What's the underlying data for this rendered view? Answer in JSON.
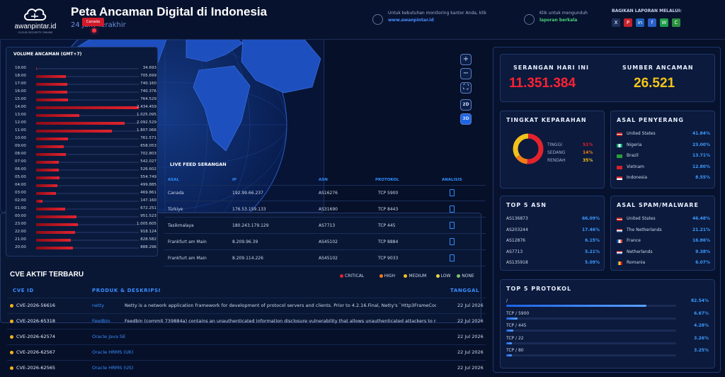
{
  "header": {
    "brand": "awanpintar.id",
    "brand_sub": "CLOUD SECURITY ONLINE",
    "title": "Peta Ancaman Digital di Indonesia",
    "subtitle": "24 Jam Terakhir",
    "promo1_text": "Untuk kebutuhan monitoring kantor Anda, klik",
    "promo1_link": "www.awanpintar.id",
    "promo2_text": "Klik untuk mengunduh",
    "promo2_link": "laporan berkala",
    "share_label": "BAGIKAN LAPORAN MELALUI:",
    "social": [
      {
        "icon": "x-icon",
        "glyph": "X",
        "color": "#1d2e59"
      },
      {
        "icon": "pinterest-icon",
        "glyph": "P",
        "color": "#c4212c"
      },
      {
        "icon": "linkedin-icon",
        "glyph": "in",
        "color": "#1f5fb8"
      },
      {
        "icon": "facebook-icon",
        "glyph": "f",
        "color": "#2a5ec9"
      },
      {
        "icon": "whatsapp-icon",
        "glyph": "W",
        "color": "#1d9c4a"
      },
      {
        "icon": "copy-icon",
        "glyph": "C",
        "color": "#2b8f3e"
      }
    ]
  },
  "volume": {
    "title": "VOLUME ANCAMAN (GMT+7)",
    "rows": [
      {
        "t": "19:00",
        "v": "34.693",
        "f": 0.01
      },
      {
        "t": "18:00",
        "v": "705.699",
        "f": 0.29
      },
      {
        "t": "17:00",
        "v": "740.160",
        "f": 0.3
      },
      {
        "t": "16:00",
        "v": "740.376",
        "f": 0.3
      },
      {
        "t": "15:00",
        "v": "764.529",
        "f": 0.31
      },
      {
        "t": "14:00",
        "v": "2.434.459",
        "f": 1.0
      },
      {
        "t": "13:00",
        "v": "1.025.095",
        "f": 0.42
      },
      {
        "t": "12:00",
        "v": "2.092.529",
        "f": 0.86
      },
      {
        "t": "11:00",
        "v": "1.807.066",
        "f": 0.74
      },
      {
        "t": "10:00",
        "v": "761.571",
        "f": 0.31
      },
      {
        "t": "09:00",
        "v": "658.053",
        "f": 0.27
      },
      {
        "t": "08:00",
        "v": "702.803",
        "f": 0.29
      },
      {
        "t": "07:00",
        "v": "542.027",
        "f": 0.22
      },
      {
        "t": "06:00",
        "v": "526.602",
        "f": 0.22
      },
      {
        "t": "05:00",
        "v": "554.749",
        "f": 0.23
      },
      {
        "t": "04:00",
        "v": "499.885",
        "f": 0.21
      },
      {
        "t": "03:00",
        "v": "469.861",
        "f": 0.19
      },
      {
        "t": "02:00",
        "v": "147.160",
        "f": 0.06
      },
      {
        "t": "01:00",
        "v": "672.251",
        "f": 0.28
      },
      {
        "t": "00:00",
        "v": "951.523",
        "f": 0.39
      },
      {
        "t": "23:00",
        "v": "1.005.605",
        "f": 0.41
      },
      {
        "t": "22:00",
        "v": "918.124",
        "f": 0.38
      },
      {
        "t": "21:00",
        "v": "828.582",
        "f": 0.34
      },
      {
        "t": "20:00",
        "v": "888.296",
        "f": 0.36
      }
    ]
  },
  "map": {
    "marker_label": "Canada",
    "buttons": {
      "zoom_in": "+",
      "zoom_out": "−",
      "fit": "⛶",
      "view_2d": "2D",
      "view_3d": "3D"
    }
  },
  "live_feed": {
    "title": "LIVE FEED SERANGAN",
    "headers": {
      "asal": "ASAL",
      "ip": "IP",
      "asn": "ASN",
      "protokol": "PROTOKOL",
      "analisis": "ANALISIS"
    },
    "rows": [
      {
        "asal": "Canada",
        "ip": "192.99.66.237",
        "asn": "AS16276",
        "protokol": "TCP 5900"
      },
      {
        "asal": "Türkiye",
        "ip": "176.53.159.133",
        "asn": "AS31690",
        "protokol": "TCP 8443"
      },
      {
        "asal": "Tasikmalaya",
        "ip": "180.243.179.129",
        "asn": "AS7713",
        "protokol": "TCP 445"
      },
      {
        "asal": "Frankfurt am Main",
        "ip": "8.209.96.39",
        "asn": "AS45102",
        "protokol": "TCP 8884"
      },
      {
        "asal": "Frankfurt am Main",
        "ip": "8.209.114.226",
        "asn": "AS45102",
        "protokol": "TCP 9033"
      }
    ]
  },
  "cve": {
    "title": "CVE AKTIF TERBARU",
    "legend": [
      {
        "label": "CRITICAL",
        "color": "#e2232e"
      },
      {
        "label": "HIGH",
        "color": "#f07c1a"
      },
      {
        "label": "MEDIUM",
        "color": "#f2c21b"
      },
      {
        "label": "LOW",
        "color": "#e6d84a"
      },
      {
        "label": "NONE",
        "color": "#7cc46a"
      }
    ],
    "headers": {
      "id": "CVE ID",
      "produk": "PRODUK & DESKRIPSI",
      "tanggal": "TANGGAL"
    },
    "rows": [
      {
        "id": "CVE-2026-56616",
        "produk": "netty",
        "desc": "Netty is a network application framework for development of protocol servers and clients. Prior to 4.2.16.Final, Netty's `Http3FrameCodec` ...",
        "tanggal": "22 Jul 2026"
      },
      {
        "id": "CVE-2026-65318",
        "produk": "Feedbin",
        "desc": "Feedbin (commit 739884a) contains an unauthenticated information disclosure vulnerability that allows unauthenticated attackers to retr...",
        "tanggal": "22 Jul 2026"
      },
      {
        "id": "CVE-2026-62574",
        "produk": "Oracle Java SE",
        "desc": "",
        "tanggal": "22 Jul 2026"
      },
      {
        "id": "CVE-2026-62567",
        "produk": "Oracle HRMS (UK)",
        "desc": "",
        "tanggal": "22 Jul 2026"
      },
      {
        "id": "CVE-2026-62565",
        "produk": "Oracle HRMS (US)",
        "desc": "",
        "tanggal": "22 Jul 2026"
      }
    ]
  },
  "stats": {
    "serangan_label": "SERANGAN HARI INI",
    "serangan_value": "11.351.384",
    "sumber_label": "SUMBER ANCAMAN",
    "sumber_value": "26.521",
    "keparahan": {
      "title": "TINGKAT KEPARAHAN",
      "items": [
        {
          "label": "TINGGI",
          "pct": "51%",
          "value": 51,
          "color": "#e2232e"
        },
        {
          "label": "SEDANG",
          "pct": "14%",
          "value": 14,
          "color": "#f07c1a"
        },
        {
          "label": "RENDAH",
          "pct": "35%",
          "value": 35,
          "color": "#f2c21b"
        }
      ]
    },
    "penyerang": {
      "title": "ASAL PENYERANG",
      "items": [
        {
          "name": "United States",
          "pct": "41.84%"
        },
        {
          "name": "Nigeria",
          "pct": "23.00%"
        },
        {
          "name": "Brazil",
          "pct": "13.71%"
        },
        {
          "name": "Vietnam",
          "pct": "12.80%"
        },
        {
          "name": "Indonesia",
          "pct": "8.55%"
        }
      ]
    },
    "asn": {
      "title": "TOP 5 ASN",
      "items": [
        {
          "name": "AS136873",
          "pct": "66.09%"
        },
        {
          "name": "AS203244",
          "pct": "17.46%"
        },
        {
          "name": "AS12876",
          "pct": "6.15%"
        },
        {
          "name": "AS7713",
          "pct": "5.21%"
        },
        {
          "name": "AS135918",
          "pct": "5.09%"
        }
      ]
    },
    "spam": {
      "title": "ASAL SPAM/MALWARE",
      "items": [
        {
          "name": "United States",
          "pct": "46.48%"
        },
        {
          "name": "The Netherlands",
          "pct": "21.21%"
        },
        {
          "name": "France",
          "pct": "16.86%"
        },
        {
          "name": "Netherlands",
          "pct": "9.38%"
        },
        {
          "name": "Romania",
          "pct": "6.07%"
        }
      ]
    },
    "protokol": {
      "title": "TOP 5 PROTOKOL",
      "items": [
        {
          "name": "/",
          "pct": "82.54%",
          "value": 82.54
        },
        {
          "name": "TCP / 5900",
          "pct": "6.67%",
          "value": 6.67
        },
        {
          "name": "TCP / 445",
          "pct": "4.28%",
          "value": 4.28
        },
        {
          "name": "TCP / 22",
          "pct": "3.26%",
          "value": 3.26
        },
        {
          "name": "TCP / 80",
          "pct": "3.25%",
          "value": 3.25
        }
      ]
    }
  }
}
